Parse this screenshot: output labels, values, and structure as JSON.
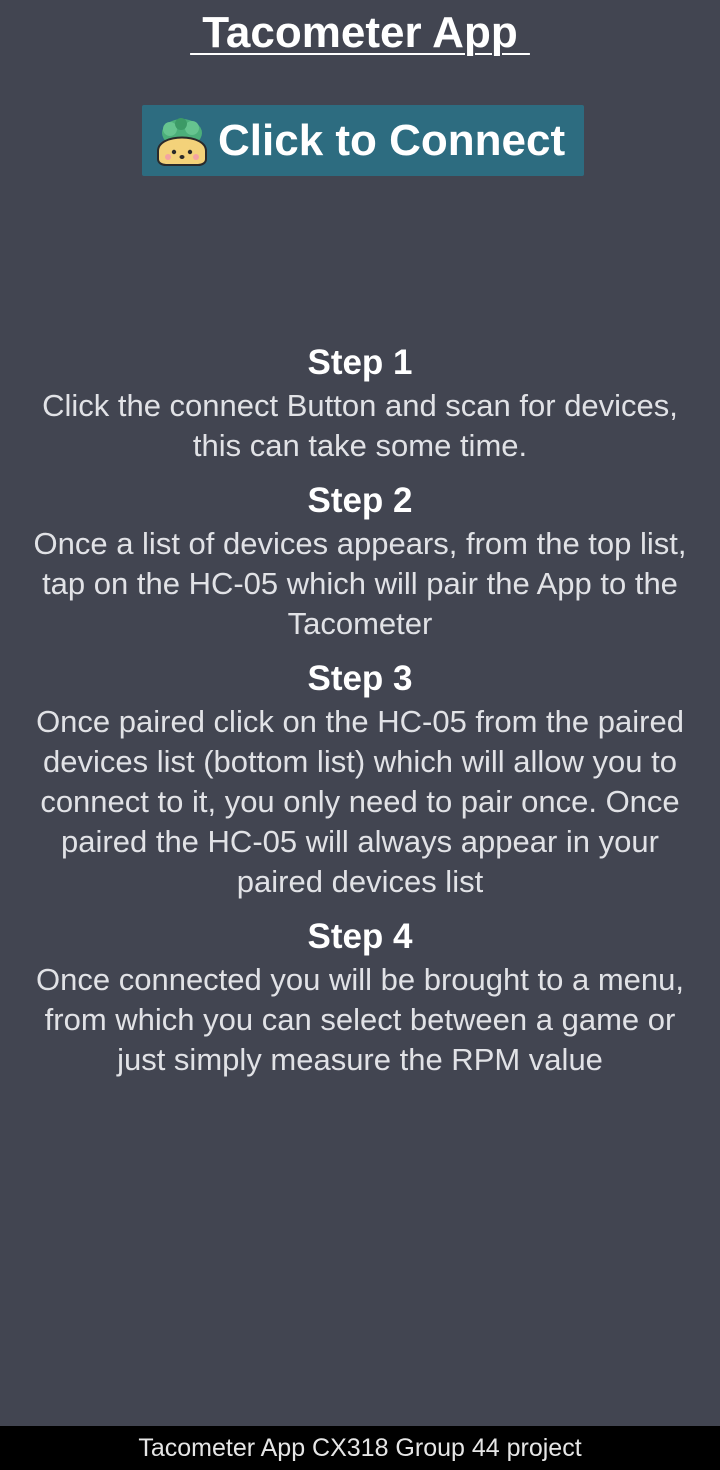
{
  "header": {
    "title": " Tacometer App "
  },
  "connect_button": {
    "label": "Click to Connect",
    "icon": "taco-icon"
  },
  "steps": [
    {
      "title": "Step 1",
      "text": "Click the connect Button and scan for devices, this can take some time."
    },
    {
      "title": "Step 2",
      "text": "Once a list of devices appears, from the top list, tap on the HC-05 which will pair the App to the Tacometer"
    },
    {
      "title": "Step 3",
      "text": "Once paired click on the HC-05 from the paired devices list (bottom list) which will allow you to connect to it, you only need to pair once. Once paired the HC-05 will always appear in your paired devices list"
    },
    {
      "title": "Step 4",
      "text": "Once connected you will be brought to a menu, from which you can select between a game or just simply measure the RPM value"
    }
  ],
  "footer": {
    "text": "Tacometer App CX318 Group 44 project"
  },
  "colors": {
    "background": "#424551",
    "button": "#2d6c80",
    "footer_background": "#000000",
    "text": "#ffffff"
  }
}
